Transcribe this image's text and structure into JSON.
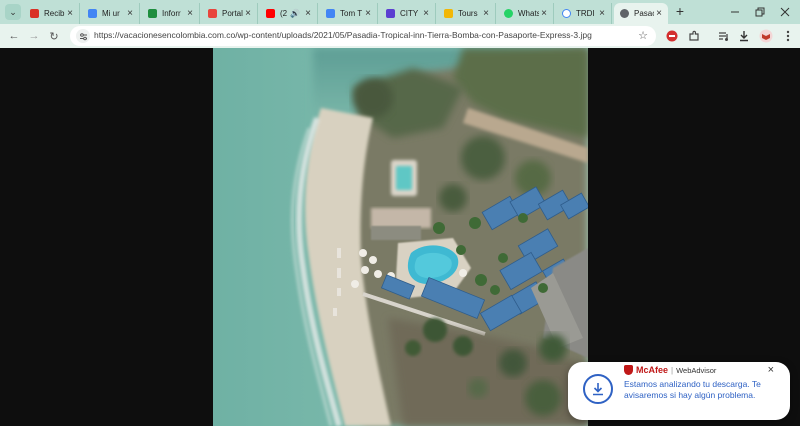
{
  "tabs": [
    {
      "title": "Recib",
      "favicon_color": "#d93025"
    },
    {
      "title": "Mi ur",
      "favicon_color": "#4285f4"
    },
    {
      "title": "Inforr",
      "favicon_color": "#1e8e3e"
    },
    {
      "title": "Portal",
      "favicon_color": "#e8453c"
    },
    {
      "title": "(2",
      "favicon_color": "#ff0000"
    },
    {
      "title": "Tom T",
      "favicon_color": "#4285f4"
    },
    {
      "title": "CITY",
      "favicon_color": "#5b3fd1"
    },
    {
      "title": "Tours",
      "favicon_color": "#f2b705"
    },
    {
      "title": "Whats",
      "favicon_color": "#25d366"
    },
    {
      "title": "TRDI",
      "favicon_color": "#5f6368"
    },
    {
      "title": "Pasac",
      "favicon_color": "#5f6368"
    }
  ],
  "address_bar": {
    "url": "https://vacacionesencolombia.com.co/wp-content/uploads/2021/05/Pasadia-Tropical-inn-Tierra-Bomba-con-Pasaporte-Express-3.jpg"
  },
  "notification": {
    "brand": "McAfee",
    "product": "WebAdvisor",
    "message": "Estamos analizando tu descarga. Te avisaremos si hay algún problema."
  }
}
